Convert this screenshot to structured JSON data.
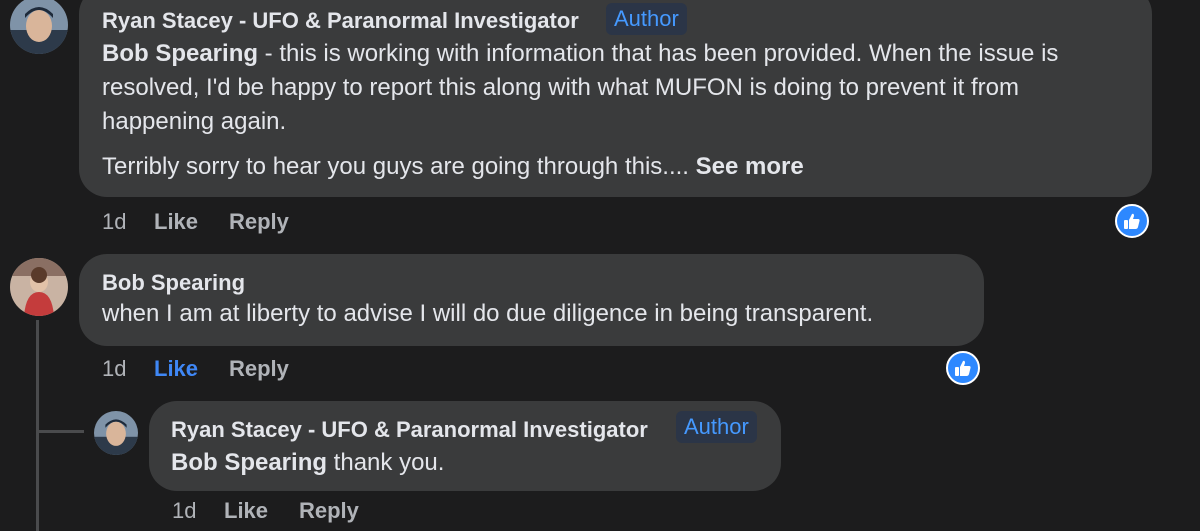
{
  "comments": [
    {
      "author": "Ryan Stacey - UFO & Paranormal Investigator",
      "badge": "Author",
      "paragraph1_mention": "Bob Spearing",
      "paragraph1_text": " - this is working with information that has been provided. When the issue is resolved, I'd be happy to report this along with what MUFON is doing to prevent it from happening again.",
      "paragraph2_text": "Terribly sorry to hear you guys are going through this.... ",
      "see_more": "See more",
      "time": "1d",
      "like_label": "Like",
      "reply_label": "Reply"
    },
    {
      "author": "Bob Spearing",
      "text": "when I am at liberty to advise I will do due diligence in being transparent.",
      "time": "1d",
      "like_label": "Like",
      "reply_label": "Reply",
      "liked": true
    },
    {
      "author": "Ryan Stacey - UFO & Paranormal Investigator",
      "badge": "Author",
      "mention": "Bob Spearing",
      "text": " thank you.",
      "time": "1d",
      "like_label": "Like",
      "reply_label": "Reply"
    }
  ],
  "colors": {
    "background": "#1c1c1d",
    "bubble": "#3a3b3c",
    "accent": "#2d88ff",
    "badge_text": "#4599ff",
    "muted": "#b0b3b8"
  }
}
